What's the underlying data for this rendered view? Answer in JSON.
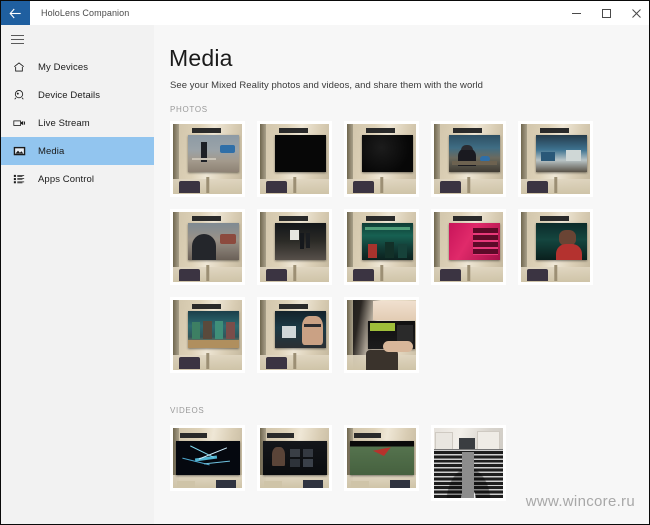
{
  "window": {
    "title": "HoloLens Companion",
    "back_icon": "back-arrow-icon",
    "controls": {
      "minimize": "minimize-icon",
      "maximize": "maximize-icon",
      "close": "close-icon"
    }
  },
  "sidebar": {
    "menu_icon": "hamburger-icon",
    "items": [
      {
        "label": "My Devices",
        "icon": "home-icon",
        "selected": false
      },
      {
        "label": "Device Details",
        "icon": "device-icon",
        "selected": false
      },
      {
        "label": "Live Stream",
        "icon": "video-camera-icon",
        "selected": false
      },
      {
        "label": "Media",
        "icon": "photo-icon",
        "selected": true
      },
      {
        "label": "Apps Control",
        "icon": "list-icon",
        "selected": false
      }
    ],
    "selected_color": "#92c5ef",
    "background_color": "#f2f2f2"
  },
  "main": {
    "title": "Media",
    "subtitle": "See your Mixed Reality photos and videos, and share them with the world",
    "sections": [
      {
        "label": "PHOTOS",
        "rows": [
          [
            {
              "name": "photo-1",
              "screen": "person-standing-outdoor-scene"
            },
            {
              "name": "photo-2",
              "screen": "black-screen"
            },
            {
              "name": "photo-3",
              "screen": "black-screen"
            },
            {
              "name": "photo-4",
              "screen": "person-at-desk-with-cap"
            },
            {
              "name": "photo-5",
              "screen": "blue-indoor-scene"
            }
          ],
          [
            {
              "name": "photo-6",
              "screen": "person-closeup-street"
            },
            {
              "name": "photo-7",
              "screen": "night-street-figures"
            },
            {
              "name": "photo-8",
              "screen": "green-lit-venue-crowd"
            },
            {
              "name": "photo-9",
              "screen": "pink-lit-shelves"
            },
            {
              "name": "photo-10",
              "screen": "woman-in-red-teal-background"
            }
          ],
          [
            {
              "name": "photo-11",
              "screen": "crowd-teal-workshop"
            },
            {
              "name": "photo-12",
              "screen": "man-with-glasses-dark-room"
            },
            {
              "name": "photo-13",
              "screen": "desk-with-green-monitor"
            }
          ]
        ]
      },
      {
        "label": "VIDEOS",
        "rows": [
          [
            {
              "name": "video-1",
              "screen": "blue-network-graphic",
              "tall": false
            },
            {
              "name": "video-2",
              "screen": "presenter-with-slide-grid",
              "tall": false
            },
            {
              "name": "video-3",
              "screen": "red-paper-plane-on-green",
              "tall": false
            },
            {
              "name": "video-4",
              "screen": "bw-amphitheater-hall",
              "tall": true
            }
          ]
        ]
      }
    ]
  },
  "watermark": "www.wincore.ru",
  "colors": {
    "titlebar_accent": "#1f5fa0",
    "content_background": "#f7f7f7",
    "window_border": "#0a0a0a"
  }
}
